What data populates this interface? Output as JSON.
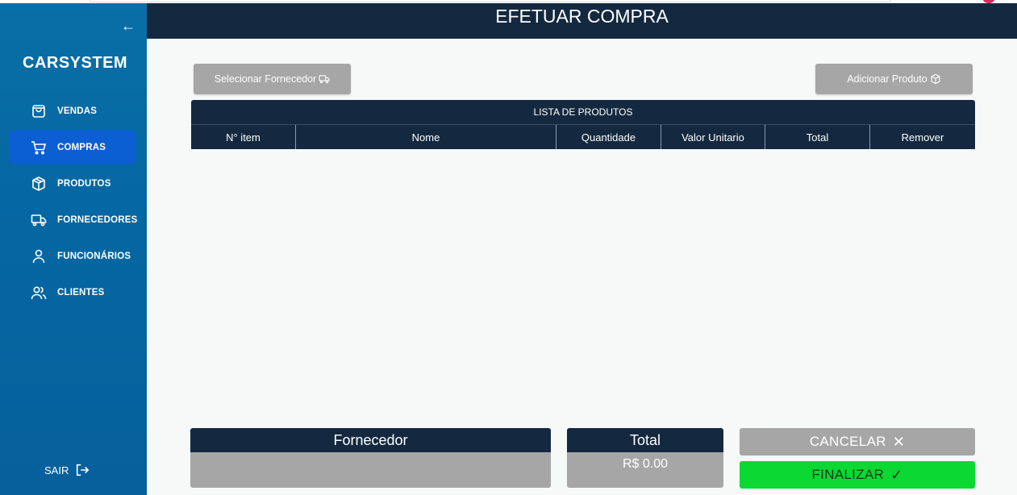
{
  "header": {
    "title": "EFETUAR COMPRA"
  },
  "sidebar": {
    "brand": "CARSYSTEM",
    "items": [
      {
        "label": "VENDAS",
        "icon": "shopping-bag-icon",
        "active": false
      },
      {
        "label": "COMPRAS",
        "icon": "cart-icon",
        "active": true
      },
      {
        "label": "PRODUTOS",
        "icon": "box-icon",
        "active": false
      },
      {
        "label": "FORNECEDORES",
        "icon": "truck-icon",
        "active": false
      },
      {
        "label": "FUNCIONÁRIOS",
        "icon": "user-icon",
        "active": false
      },
      {
        "label": "CLIENTES",
        "icon": "users-icon",
        "active": false
      }
    ],
    "logout_label": "SAIR",
    "accent": "#0c5fd2"
  },
  "toolbar": {
    "select_supplier_label": "Selecionar Fornecedor",
    "add_product_label": "Adicionar Produto"
  },
  "table": {
    "caption": "LISTA DE PRODUTOS",
    "columns": [
      "N° item",
      "Nome",
      "Quantidade",
      "Valor Unitario",
      "Total",
      "Remover"
    ],
    "rows": []
  },
  "summary": {
    "supplier_label": "Fornecedor",
    "supplier_value": "",
    "total_label": "Total",
    "total_value": "R$ 0.00"
  },
  "actions": {
    "cancel_label": "CANCELAR",
    "finish_label": "FINALIZAR",
    "finish_color": "#0bd833"
  }
}
